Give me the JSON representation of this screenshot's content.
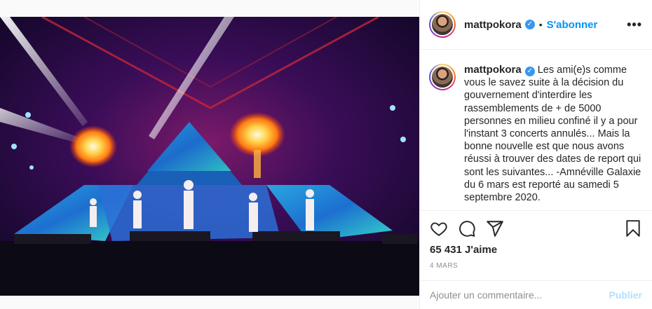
{
  "post": {
    "username": "mattpokora",
    "verified_icon": "verified-badge-icon",
    "dot": "•",
    "follow_label": "S'abonner",
    "more_label": "•••",
    "caption": "Les ami(e)s comme vous le savez suite à la décision du gouvernement d'interdire les rassemblements de + de 5000 personnes en milieu confiné il y a pour l'instant 3 concerts annulés... Mais la bonne nouvelle est que nous avons réussi à trouver des dates de report qui sont les suivantes... -Amnéville Galaxie du 6 mars est reporté au samedi 5 septembre 2020.",
    "likes": "65 431 J'aime",
    "date": "4 mars",
    "comment_placeholder": "Ajouter un commentaire...",
    "publish_label": "Publier"
  },
  "icons": {
    "like": "heart-icon",
    "comment": "comment-icon",
    "share": "share-icon",
    "save": "bookmark-icon"
  },
  "colors": {
    "link_blue": "#0095f6",
    "verified_blue": "#3897f0",
    "publish_disabled": "#b2dffc",
    "muted": "#8e8e8e"
  }
}
